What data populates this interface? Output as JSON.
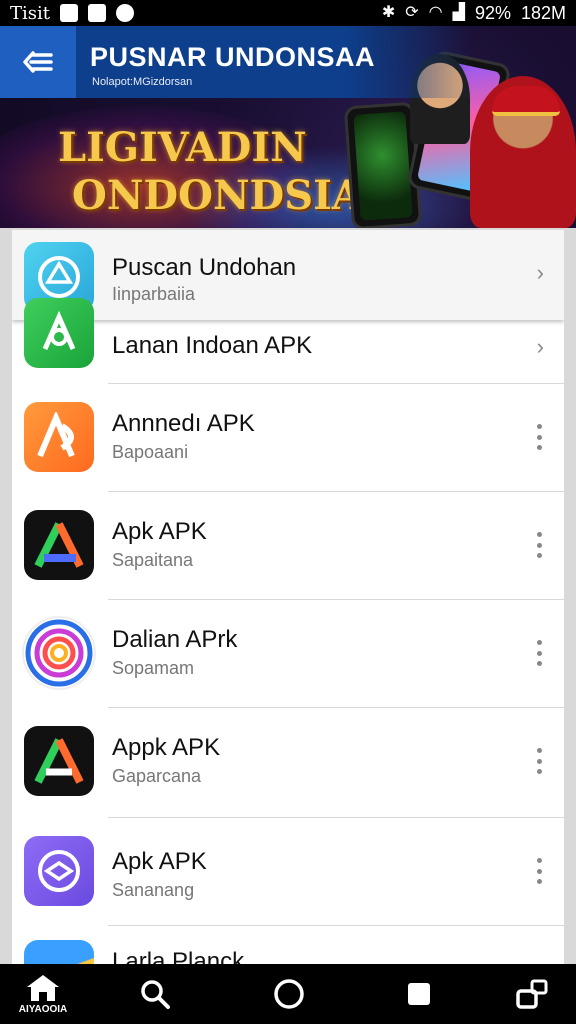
{
  "status_bar": {
    "carrier": "Tisit",
    "battery": "92%",
    "time": "182M"
  },
  "header": {
    "title": "PUSNAR UNDONSAA",
    "subtitle": "Nolapot:MGizdorsan"
  },
  "banner": {
    "line1": "LIGIVADIN",
    "line2": "ONDONDSIA"
  },
  "list": {
    "items": [
      {
        "title": "Puscan Undohan",
        "subtitle": "Iinparbaiia",
        "action": "chevron"
      },
      {
        "title": "Lanan Indoan APK",
        "subtitle": "",
        "action": "chevron"
      },
      {
        "title": "Annnedı APK",
        "subtitle": "Bapoaani",
        "action": "more"
      },
      {
        "title": "Apk APK",
        "subtitle": "Sapaitana",
        "action": "more"
      },
      {
        "title": "Dalian APrk",
        "subtitle": "Sopamam",
        "action": "more"
      },
      {
        "title": "Appk APK",
        "subtitle": "Gaparcana",
        "action": "more"
      },
      {
        "title": "Apk APK",
        "subtitle": "Sananang",
        "action": "more"
      },
      {
        "title": "Larla Planck",
        "subtitle": "",
        "action": "none"
      }
    ]
  },
  "bottom_nav": {
    "home_label": "AIYAOOIA"
  },
  "colors": {
    "header_bg": "#0d3f8c",
    "back_button_bg": "#1f5fbf",
    "banner_text": "#f6c84b"
  }
}
